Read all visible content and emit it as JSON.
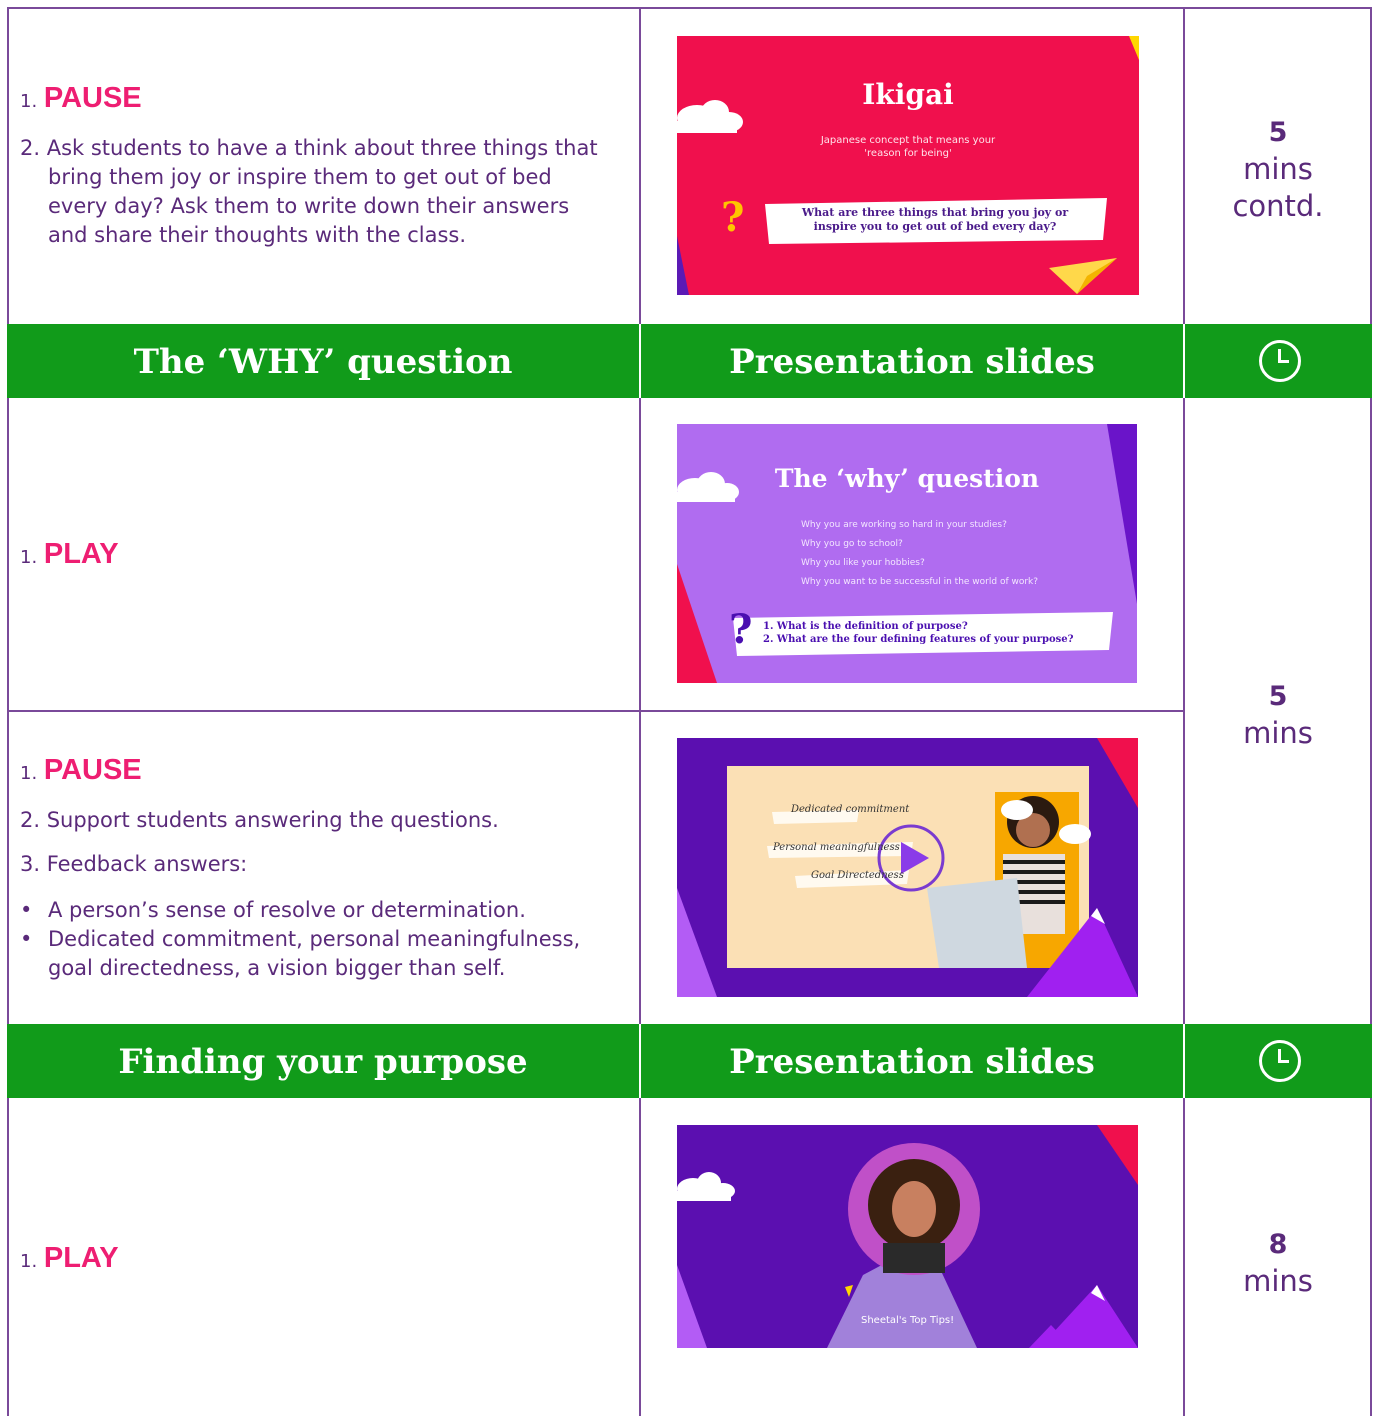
{
  "section1": {
    "steps": {
      "n1": "1.",
      "k1": "PAUSE",
      "p2_l1": "2. Ask students to have a think about three things that",
      "p2_l2": "bring them joy or inspire them to get out of bed",
      "p2_l3": "every day? Ask them to write down their answers",
      "p2_l4": "and share their thoughts with the class."
    },
    "slide": {
      "title": "Ikigai",
      "subtitle_l1": "Japanese concept that means your",
      "subtitle_l2": "'reason for being'",
      "question_l1": "What are three things that bring you joy or",
      "question_l2": "inspire you to get out of bed every day?",
      "qmark": "?"
    },
    "time": {
      "n": "5",
      "unit": "mins",
      "note": "contd."
    }
  },
  "bar1": {
    "activity": "The ‘WHY’ question",
    "resources": "Presentation slides"
  },
  "section2a": {
    "n1": "1.",
    "k1": "PLAY",
    "slide": {
      "title": "The ‘why’ question",
      "lines": [
        "Why you are working so hard in your studies?",
        "Why you go to school?",
        "Why you like your hobbies?",
        "Why you want to be successful in the world of work?"
      ],
      "q1": "1. What is the definition of purpose?",
      "q2": "2. What are the four defining features of your purpose?",
      "qmark": "?"
    }
  },
  "section2b": {
    "n1": "1.",
    "k1": "PAUSE",
    "p2": "2. Support students answering the questions.",
    "p3": "3. Feedback answers:",
    "b1": "A person’s sense of resolve or determination.",
    "b2_l1": "Dedicated commitment, personal meaningfulness,",
    "b2_l2": "goal directedness, a vision bigger than self.",
    "bullet": "•",
    "slide": {
      "tag1": "Dedicated commitment",
      "tag2": "Personal meaningfulness",
      "tag3": "Goal Directedness"
    }
  },
  "time2": {
    "n": "5",
    "unit": "mins"
  },
  "bar2": {
    "activity": "Finding your purpose",
    "resources": "Presentation slides"
  },
  "section3": {
    "n1": "1.",
    "k1": "PLAY",
    "slide": {
      "caption": "Sheetal's Top Tips!"
    },
    "time": {
      "n": "8",
      "unit": "mins"
    }
  },
  "colors": {
    "bar_green": "#119b1a",
    "keyword_pink": "#ee1e72",
    "text_purple": "#5a2a7a"
  }
}
